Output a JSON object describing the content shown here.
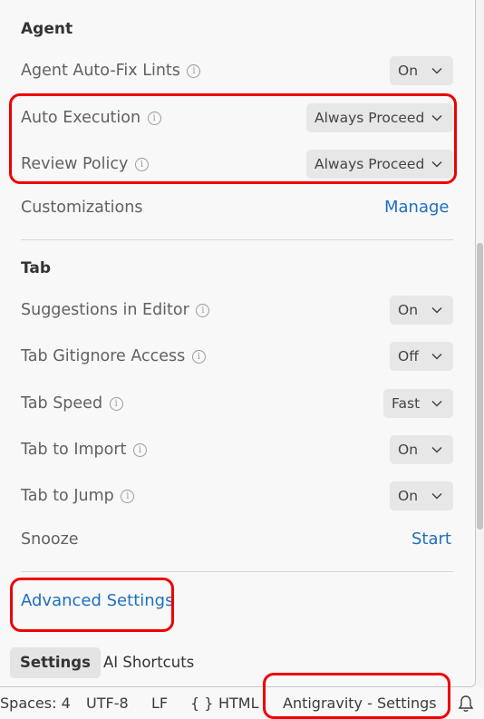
{
  "agent": {
    "title": "Agent",
    "rows": [
      {
        "label": "Agent Auto-Fix Lints",
        "value": "On"
      },
      {
        "label": "Auto Execution",
        "value": "Always Proceed"
      },
      {
        "label": "Review Policy",
        "value": "Always Proceed"
      }
    ],
    "customizations": {
      "label": "Customizations",
      "link": "Manage"
    }
  },
  "tab": {
    "title": "Tab",
    "rows": [
      {
        "label": "Suggestions in Editor",
        "value": "On"
      },
      {
        "label": "Tab Gitignore Access",
        "value": "Off"
      },
      {
        "label": "Tab Speed",
        "value": "Fast"
      },
      {
        "label": "Tab to Import",
        "value": "On"
      },
      {
        "label": "Tab to Jump",
        "value": "On"
      }
    ],
    "snooze": {
      "label": "Snooze",
      "link": "Start"
    }
  },
  "advanced_settings": "Advanced Settings",
  "bottom_tabs": [
    {
      "label": "Settings",
      "active": true
    },
    {
      "label": "AI Shortcuts",
      "active": false
    }
  ],
  "info_glyph": "i",
  "statusbar": {
    "spaces": "Spaces: 4",
    "encoding": "UTF-8",
    "eol": "LF",
    "braces": "{ }",
    "language": "HTML",
    "window_title": "Antigravity - Settings",
    "bell_icon": "bell-icon"
  },
  "colors": {
    "link": "#1e6fbf",
    "highlight": "#ee0000"
  }
}
